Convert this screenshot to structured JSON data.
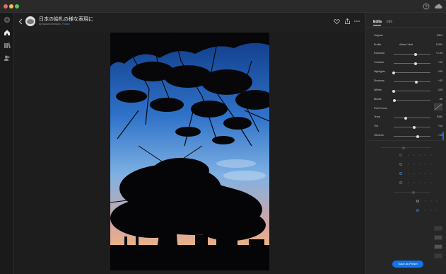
{
  "header": {
    "title": "日本の絵札の様な表現に",
    "byline": "by Sakuma Kimura",
    "follow": "Follow"
  },
  "tabs": {
    "edits": "Edits",
    "info": "Info"
  },
  "panel": {
    "original_label": "Original",
    "original_value": "DNG",
    "profile_label": "Profile",
    "profile_value": "Adobe Vivid",
    "profile_amount": "100%",
    "point_curve": "Point Curve",
    "sliders": [
      {
        "label": "Exposure",
        "value": "+1.09",
        "pos": 0.6
      },
      {
        "label": "Contrast",
        "value": "+22",
        "pos": 0.6
      },
      {
        "label": "Highlights",
        "value": "-100",
        "pos": 0.0
      },
      {
        "label": "Shadows",
        "value": "+30",
        "pos": 0.62
      },
      {
        "label": "Whites",
        "value": "-100",
        "pos": 0.0
      },
      {
        "label": "Blacks",
        "value": "-96",
        "pos": 0.02
      },
      {
        "label": "Temp",
        "value": "5350",
        "pos": 0.33
      },
      {
        "label": "Tint",
        "value": "+10",
        "pos": 0.55
      },
      {
        "label": "Vibrance",
        "value": "+20",
        "pos": 0.66
      }
    ]
  },
  "save_preset": "Save as Preset",
  "colors": {
    "accent": "#1473e6",
    "panel": "#262626",
    "bg": "#1f1f1f"
  },
  "icons": [
    "close-dot-icon",
    "minimize-dot-icon",
    "zoom-dot-icon",
    "help-icon",
    "cloud-icon",
    "add-icon",
    "home-icon",
    "library-icon",
    "people-icon",
    "back-icon",
    "heart-icon",
    "share-icon",
    "more-icon"
  ]
}
